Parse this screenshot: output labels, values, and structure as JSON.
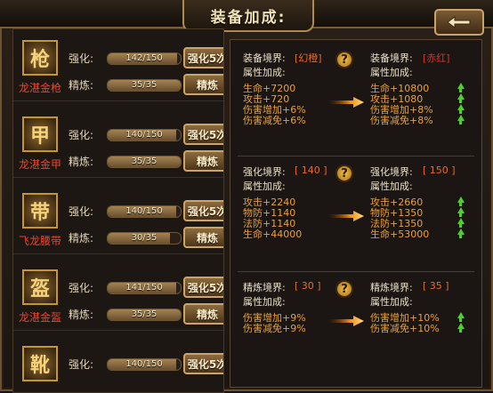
{
  "window": {
    "title": "装备加成:",
    "back_icon": "back-arrow-icon"
  },
  "items": [
    {
      "name": "龙湛金枪",
      "icon": "spear-icon",
      "glyph": "枪",
      "enhance_label": "强化:",
      "enhance_value": "142/150",
      "enhance_ratio": 0.947,
      "enhance_button": "强化5次",
      "refine_label": "精炼:",
      "refine_value": "35/35",
      "refine_ratio": 1.0,
      "refine_button": "精炼"
    },
    {
      "name": "龙湛金甲",
      "icon": "armor-icon",
      "glyph": "甲",
      "enhance_label": "强化:",
      "enhance_value": "140/150",
      "enhance_ratio": 0.933,
      "enhance_button": "强化5次",
      "refine_label": "精炼:",
      "refine_value": "35/35",
      "refine_ratio": 1.0,
      "refine_button": "精炼"
    },
    {
      "name": "飞龙腰带",
      "icon": "belt-icon",
      "glyph": "带",
      "enhance_label": "强化:",
      "enhance_value": "140/150",
      "enhance_ratio": 0.933,
      "enhance_button": "强化5次",
      "refine_label": "精炼:",
      "refine_value": "30/35",
      "refine_ratio": 0.857,
      "refine_button": "精炼"
    },
    {
      "name": "龙湛金盔",
      "icon": "helmet-icon",
      "glyph": "盔",
      "enhance_label": "强化:",
      "enhance_value": "141/150",
      "enhance_ratio": 0.94,
      "enhance_button": "强化5次",
      "refine_label": "精炼:",
      "refine_value": "35/35",
      "refine_ratio": 1.0,
      "refine_button": "精炼"
    },
    {
      "name": "",
      "icon": "boots-icon",
      "glyph": "靴",
      "enhance_label": "强化:",
      "enhance_value": "140/150",
      "enhance_ratio": 0.933,
      "enhance_button": "强化5次",
      "refine_label": "",
      "refine_value": "",
      "refine_ratio": 0,
      "refine_button": ""
    }
  ],
  "sections": [
    {
      "left_realm_label": "装备境界:",
      "left_realm_value": "[幻橙]",
      "right_realm_label": "装备境界:",
      "right_realm_value": "[赤红]",
      "attr_label": "属性加成:",
      "left_attrs": [
        "生命+7200",
        "攻击+720",
        "伤害增加+6%",
        "伤害减免+6%"
      ],
      "right_attrs": [
        "生命+10800",
        "攻击+1080",
        "伤害增加+8%",
        "伤害减免+8%"
      ]
    },
    {
      "left_realm_label": "强化境界:",
      "left_realm_value": "[ 140 ]",
      "right_realm_label": "强化境界:",
      "right_realm_value": "[ 150 ]",
      "attr_label": "属性加成:",
      "left_attrs": [
        "攻击+2240",
        "物防+1140",
        "法防+1140",
        "生命+44000"
      ],
      "right_attrs": [
        "攻击+2660",
        "物防+1350",
        "法防+1350",
        "生命+53000"
      ]
    },
    {
      "left_realm_label": "精炼境界:",
      "left_realm_value": "[ 30 ]",
      "right_realm_label": "精炼境界:",
      "right_realm_value": "[ 35 ]",
      "attr_label": "属性加成:",
      "left_attrs": [
        "伤害增加+9%",
        "伤害减免+9%"
      ],
      "right_attrs": [
        "伤害增加+10%",
        "伤害减免+10%"
      ]
    }
  ],
  "help_glyph": "?",
  "colors": {
    "accent_gold": "#c9a46a",
    "up_green": "#4fcf2e",
    "name_red": "#e9452e",
    "value_orange": "#e9a03a"
  }
}
